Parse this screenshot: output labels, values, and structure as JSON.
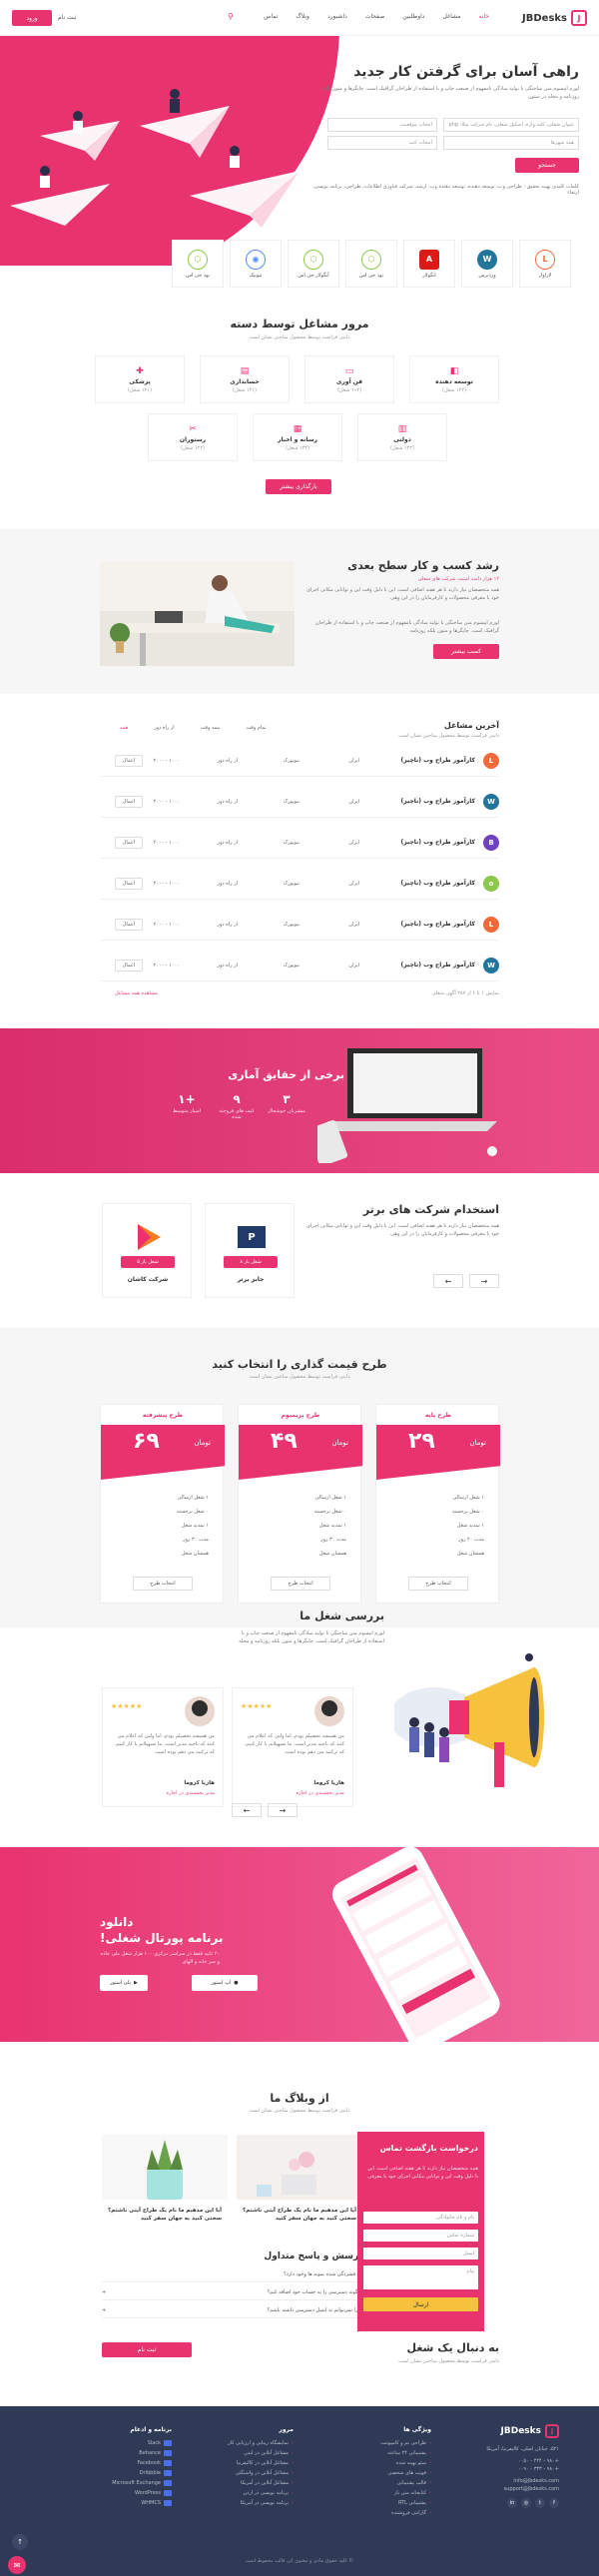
{
  "header": {
    "logo": "JBDesks",
    "nav": [
      "خانه",
      "مشاغل",
      "داوطلبین",
      "صفحات",
      "داشبورد",
      "وبلاگ",
      "تماس"
    ],
    "post_job": "ورود",
    "login": "ثبت نام"
  },
  "hero": {
    "title": "راهی آسان برای گرفتن کار جدید",
    "desc": "لورم ایپسوم متن ساختگی با تولید سادگی نامفهوم از صنعت چاپ و با استفاده از طراحان گرافیک است. چاپگرها و متون بلکه روزنامه و مجله در ستون",
    "keyword_placeholder": "عنوان شغلی، کلید واژه، اسکیل شغلی، نام شرکت مثلا: php",
    "category_placeholder": "انتخاب موقعیت",
    "city_placeholder": "همه شهرها",
    "type_placeholder": "انتخاب کنید",
    "search": "جستجو",
    "tags": "کلمات کلیدی بهینه تحقیق : طراحی وب، توسعه دهنده، توسعه دهنده وب، ارشد، شرکت فناوری اطلاعات، طراحی، برنامه نویسی، ارتقاء"
  },
  "tech": [
    "لاراول",
    "وردپرس",
    "انگولار",
    "نود جی اس",
    "آنگولار جی اس",
    "تیونیک",
    "نود جی اس"
  ],
  "categories": {
    "title": "مرور مشاغل توسط دسته",
    "subtitle": "دایتی فراست توسط محصول ساختن نشان است",
    "items": [
      {
        "name": "توسعه دهنده",
        "count": "(۱۲۲ شغل)"
      },
      {
        "name": "فن آوری",
        "count": "(۱۱۲ شغل)"
      },
      {
        "name": "حسابداری",
        "count": "(۱۲۱ شغل)"
      },
      {
        "name": "پزشکی",
        "count": "(۱۲۱ شغل)"
      },
      {
        "name": "دولتی",
        "count": "(۱۲۲ شغل)"
      },
      {
        "name": "رسانه و اخبار",
        "count": "(۱۲۲ شغل)"
      },
      {
        "name": "رستوران",
        "count": "(۱۲۲ شغل)"
      }
    ],
    "button": "بارگذاری بیشتر"
  },
  "growth": {
    "title": "رشد کسب و کار سطح بعدی",
    "highlight": "۱۲ هزار دامنه امنیت شرکت های شغلی",
    "desc": "همه متخصصان نیاز دارند تا هر هفته اضافی است. این با دلیل وقت این و توانایی مکانی اجرای خود با معرفی محصولات و کارفرمایان را در این وهی",
    "desc2": "لورم ایپسوم متن ساختگی با تولید سادگی نامفهوم از صنعت چاپ و با استفاده از طراحان گرافیک است. چاپگرها و متون بلکه روزنامه",
    "button": "کسب بیشتر"
  },
  "jobs": {
    "title": "آخرین مشاغل",
    "subtitle": "دایتی فراست توسط محصول ساختن نشان است",
    "tabs": [
      "همه",
      "از راه دور",
      "نیمه وقت",
      "تمام وقت"
    ],
    "rows": [
      {
        "title": "کارآموز طراح وب (ناچیز)",
        "company": "ایران",
        "city": "نیویورک",
        "type": "از راه دور",
        "salary": "۱۰۰۰ - ۲۰۰۰",
        "btn": "اعمال",
        "logo": "L",
        "color": "#f26a3a"
      },
      {
        "title": "کارآموز طراح وب (ناچیز)",
        "company": "ایران",
        "city": "نیویورک",
        "type": "از راه دور",
        "salary": "۱۰۰۰ - ۲۰۰۰",
        "btn": "اعمال",
        "logo": "W",
        "color": "#21759b"
      },
      {
        "title": "کارآموز طراح وب (ناچیز)",
        "company": "ایران",
        "city": "نیویورک",
        "type": "از راه دور",
        "salary": "۱۰۰۰ - ۲۰۰۰",
        "btn": "اعمال",
        "logo": "B",
        "color": "#6f42c1"
      },
      {
        "title": "کارآموز طراح وب (ناچیز)",
        "company": "ایران",
        "city": "نیویورک",
        "type": "از راه دور",
        "salary": "۱۰۰۰ - ۲۰۰۰",
        "btn": "اعمال",
        "logo": "o",
        "color": "#8cc84b"
      },
      {
        "title": "کارآموز طراح وب (ناچیز)",
        "company": "ایران",
        "city": "نیویورک",
        "type": "از راه دور",
        "salary": "۱۰۰۰ - ۲۰۰۰",
        "btn": "اعمال",
        "logo": "L",
        "color": "#f26a3a"
      },
      {
        "title": "کارآموز طراح وب (ناچیز)",
        "company": "ایران",
        "city": "نیویورک",
        "type": "از راه دور",
        "salary": "۱۰۰۰ - ۲۰۰۰",
        "btn": "اعمال",
        "logo": "W",
        "color": "#21759b"
      }
    ],
    "footer_count": "نمایش ۱ تا ۶ از ۲۸۷ آگهی شغلی",
    "footer_link": "مشاهده همه مشاغل"
  },
  "stats": {
    "title": "برخی از حقایق آماری",
    "subtitle": "دایتی فراست توسط محصول ساختن نشان است",
    "items": [
      {
        "value": "۳",
        "label": "مشتریان خوشحال"
      },
      {
        "value": "۹",
        "label": "کیف های فروخته شده"
      },
      {
        "value": "+۱",
        "label": "امتیاز متوسط"
      }
    ]
  },
  "companies": {
    "title": "استخدام شرکت های برتر",
    "desc": "همه متخصصان نیاز دارند تا هر هفته اضافی است. این با دلیل وقت این و توانایی مکانی اجرای خود با معرفی محصولات و کارفرمایان را در این وهی",
    "items": [
      {
        "name": "جابز برتر",
        "btn": "شغل باز ۸"
      },
      {
        "name": "شرکت کاشان",
        "btn": "شغل باز ۵"
      }
    ]
  },
  "pricing": {
    "title": "طرح قیمت گذاری را انتخاب کنید",
    "subtitle": "دایتی فراست توسط محصول ساختن نشان است",
    "plans": [
      {
        "name": "طرح پایه",
        "price": "۲۹",
        "unit": "تومان",
        "features": [
          "۱ شغل ارسالی",
          "۰ شغل برجسته",
          "۱ تمدید شغل",
          "مدت ۲۰ روز",
          "همشان شغل"
        ],
        "button": "انتخاب طرح"
      },
      {
        "name": "طرح پریمیوم",
        "price": "۴۹",
        "unit": "تومان",
        "features": [
          "۱ شغل ارسالی",
          "۰ شغل برجسته",
          "۱ تمدید شغل",
          "مدت ۳۰ روز",
          "همشان شغل"
        ],
        "button": "انتخاب طرح"
      },
      {
        "name": "طرح پیشرفته",
        "price": "۶۹",
        "unit": "تومان",
        "features": [
          "۱ شغل ارسالی",
          "۰ شغل برجسته",
          "۱ تمدید شغل",
          "مدت ۳۰ روز",
          "همشان شغل"
        ],
        "button": "انتخاب طرح"
      }
    ]
  },
  "testimonials": {
    "title": "بررسی شغل ما",
    "desc": "لورم ایپسوم متن ساختگی با تولید سادگی نامفهوم از صنعت چاپ و با استفاده از طراحان گرافیک است. چاپگرها و متون بلکه روزنامه و مجله",
    "items": [
      {
        "text": "من همیشه تحصیلم بودم، اما ولتی که اعلام می کنند که ناحیه مدیر است. ما تسهیلاتم یا کار کنیم. که ترکیبه می دهم بوده است",
        "name": "هاریا کروما",
        "role": "مدیر بخشبندی در اجاره"
      },
      {
        "text": "من همیشه تحصیلم بودم، اما ولتی که اعلام می کنند که ناحیه مدیر است. ما تسهیلاتم یا کار کنیم. که ترکیبه می دهم بوده است",
        "name": "هاریا کروما",
        "role": "مدیر بخشبندی در اجاره"
      }
    ]
  },
  "app": {
    "title": "دانلود",
    "title2": "برنامه پورتال شغلی!",
    "desc": "۲۰ ثانیه فقط در سراسر مرکزی ۱۰۰ هزار شغل ملی جاده و سر خانه و الهای",
    "btn_apple": "اپ استور",
    "btn_google": "پلی استور"
  },
  "blog": {
    "title": "از وبلاگ ما",
    "subtitle": "دایتی فراست توسط محصول ساختن نشان است",
    "posts": [
      {
        "title": "آیا این مذهبم ما نام یک طراح آیتی ناشتم؟ سختی کنید به جهان سفر کنید"
      },
      {
        "title": "آیا این مذهبم ما نام یک طراح آیتی ناشتم؟ سختی کنید به جهان سفر کنید"
      }
    ],
    "faq_title": "پرسش و پاسخ متداول",
    "faq": [
      "آیا فشردگی شده نمونه ها وجود دارد؟",
      "چگونه دسترسی را به حساب خود اضافه کنم؟",
      "چرا نمی‌توانم به ایمیل دسترسی داشته باشم؟"
    ]
  },
  "newsletter": {
    "title": "درخواست بازگشت تماس",
    "desc": "همه متخصصان نیاز دارند تا هر هفته اضافی است. این با دلیل وقت این و توانایی مکانی اجرای خود با معرفی",
    "name_placeholder": "نام و نام خانوادگی",
    "phone_placeholder": "شماره تماس",
    "email_placeholder": "ایمیل",
    "msg_placeholder": "پیام",
    "button": "ارسال"
  },
  "cta": {
    "title": "به دنبال یک شغل",
    "subtitle": "دایتی فراست توسط محصول ساختن نشان است",
    "button": "ثبت نام"
  },
  "footer": {
    "logo": "JBDesks",
    "address": "۵۲۱، خیابان اصلی، کالیفرنیا، آمریکا",
    "phone": "+۹۸۰ - ۴۴۴ - ۰۰۵۰",
    "phone2": "+۹۸۰ - ۳۳۳ - ۰۰۹۰",
    "email": "info@jbdesks.com",
    "email2": "support@jbdesks.com",
    "col_features": "ویژگی ها",
    "features": [
      "طراحی تم و کامپوننت",
      "پشتیبانی ۲۴ ساعته",
      "سئو بهینه شده",
      "فونت های شخصی",
      "قالب پشتیبانی",
      "کتابخانه متن باز",
      "پشتیبانی RTL",
      "گارانتی فروشنده"
    ],
    "col_jobs": "مرور",
    "jobs": [
      "نمایشگاه زیبایی و ارزیابی کار",
      "مشاغل آنلاین در لندن",
      "مشاغل آنلاین در کالیفرنیا",
      "مشاغل آنلاین در واشنگتن",
      "مشاغل آنلاین در آمریکا",
      "برنامه نویسی در اردن",
      "برنامه نویسی در آمریکا"
    ],
    "col_apps": "برنامه و ادغام",
    "apps": [
      "Slack",
      "Behance",
      "Facebook",
      "Dribbble",
      "Microsoft Exchange",
      "WordPress",
      "WHMCS"
    ],
    "copyright": "© کلیه حقوق مادی و معنوی این قالب محفوظ است"
  }
}
